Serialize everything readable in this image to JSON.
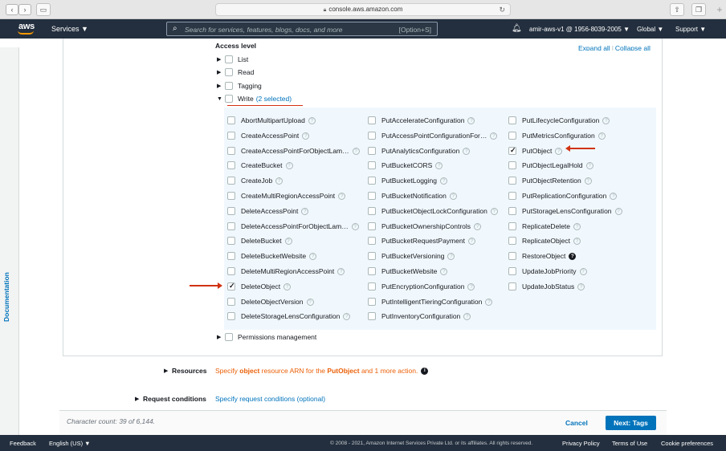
{
  "browser": {
    "back": "‹",
    "forward": "›",
    "url": "console.aws.amazon.com"
  },
  "aws_nav": {
    "logo": "aws",
    "services": "Services ▼",
    "search_placeholder": "Search for services, features, blogs, docs, and more",
    "search_shortcut": "[Option+S]",
    "account": "amir-aws-v1 @ 1956-8039-2005 ▼",
    "region": "Global ▼",
    "support": "Support ▼"
  },
  "doc_panel": {
    "label": "Documentation"
  },
  "access_level": {
    "title": "Access level",
    "expand_all": "Expand all",
    "collapse_all": "Collapse all",
    "groups": [
      {
        "label": "List"
      },
      {
        "label": "Read"
      },
      {
        "label": "Tagging"
      },
      {
        "label": "Write",
        "selected_text": "(2 selected)"
      }
    ],
    "permissions_management": "Permissions management"
  },
  "write_actions": {
    "col1": [
      {
        "label": "AbortMultipartUpload",
        "checked": false
      },
      {
        "label": "CreateAccessPoint",
        "checked": false
      },
      {
        "label": "CreateAccessPointForObjectLam…",
        "checked": false
      },
      {
        "label": "CreateBucket",
        "checked": false
      },
      {
        "label": "CreateJob",
        "checked": false
      },
      {
        "label": "CreateMultiRegionAccessPoint",
        "checked": false
      },
      {
        "label": "DeleteAccessPoint",
        "checked": false
      },
      {
        "label": "DeleteAccessPointForObjectLam…",
        "checked": false
      },
      {
        "label": "DeleteBucket",
        "checked": false
      },
      {
        "label": "DeleteBucketWebsite",
        "checked": false
      },
      {
        "label": "DeleteMultiRegionAccessPoint",
        "checked": false
      },
      {
        "label": "DeleteObject",
        "checked": true
      },
      {
        "label": "DeleteObjectVersion",
        "checked": false
      },
      {
        "label": "DeleteStorageLensConfiguration",
        "checked": false
      }
    ],
    "col2": [
      {
        "label": "PutAccelerateConfiguration",
        "checked": false
      },
      {
        "label": "PutAccessPointConfigurationFor…",
        "checked": false
      },
      {
        "label": "PutAnalyticsConfiguration",
        "checked": false
      },
      {
        "label": "PutBucketCORS",
        "checked": false
      },
      {
        "label": "PutBucketLogging",
        "checked": false
      },
      {
        "label": "PutBucketNotification",
        "checked": false
      },
      {
        "label": "PutBucketObjectLockConfiguration",
        "checked": false
      },
      {
        "label": "PutBucketOwnershipControls",
        "checked": false
      },
      {
        "label": "PutBucketRequestPayment",
        "checked": false
      },
      {
        "label": "PutBucketVersioning",
        "checked": false
      },
      {
        "label": "PutBucketWebsite",
        "checked": false
      },
      {
        "label": "PutEncryptionConfiguration",
        "checked": false
      },
      {
        "label": "PutIntelligentTieringConfiguration",
        "checked": false
      },
      {
        "label": "PutInventoryConfiguration",
        "checked": false
      }
    ],
    "col3": [
      {
        "label": "PutLifecycleConfiguration",
        "checked": false
      },
      {
        "label": "PutMetricsConfiguration",
        "checked": false
      },
      {
        "label": "PutObject",
        "checked": true
      },
      {
        "label": "PutObjectLegalHold",
        "checked": false
      },
      {
        "label": "PutObjectRetention",
        "checked": false
      },
      {
        "label": "PutReplicationConfiguration",
        "checked": false
      },
      {
        "label": "PutStorageLensConfiguration",
        "checked": false
      },
      {
        "label": "ReplicateDelete",
        "checked": false
      },
      {
        "label": "ReplicateObject",
        "checked": false
      },
      {
        "label": "RestoreObject",
        "checked": false,
        "dark_info": true
      },
      {
        "label": "UpdateJobPriority",
        "checked": false
      },
      {
        "label": "UpdateJobStatus",
        "checked": false
      }
    ]
  },
  "resources": {
    "label": "Resources",
    "text_pre": "Specify ",
    "text_obj": "object",
    "text_mid": " resource ARN for the ",
    "text_put": "PutObject",
    "text_post": " and 1 more action."
  },
  "request_conditions": {
    "label": "Request conditions",
    "link": "Specify request conditions (optional)"
  },
  "footer_actions": {
    "char_count": "Character count: 39 of 6,144.",
    "cancel": "Cancel",
    "next": "Next: Tags"
  },
  "site_footer": {
    "feedback": "Feedback",
    "language": "English (US) ▼",
    "copyright": "© 2008 - 2021, Amazon Internet Services Private Ltd. or its affiliates. All rights reserved.",
    "privacy": "Privacy Policy",
    "terms": "Terms of Use",
    "cookies": "Cookie preferences"
  },
  "colors": {
    "aws_nav": "#232f3e",
    "link": "#0073bb",
    "warning": "#eb5f07",
    "annotation": "#d13212",
    "panel": "#f1f8fd"
  }
}
